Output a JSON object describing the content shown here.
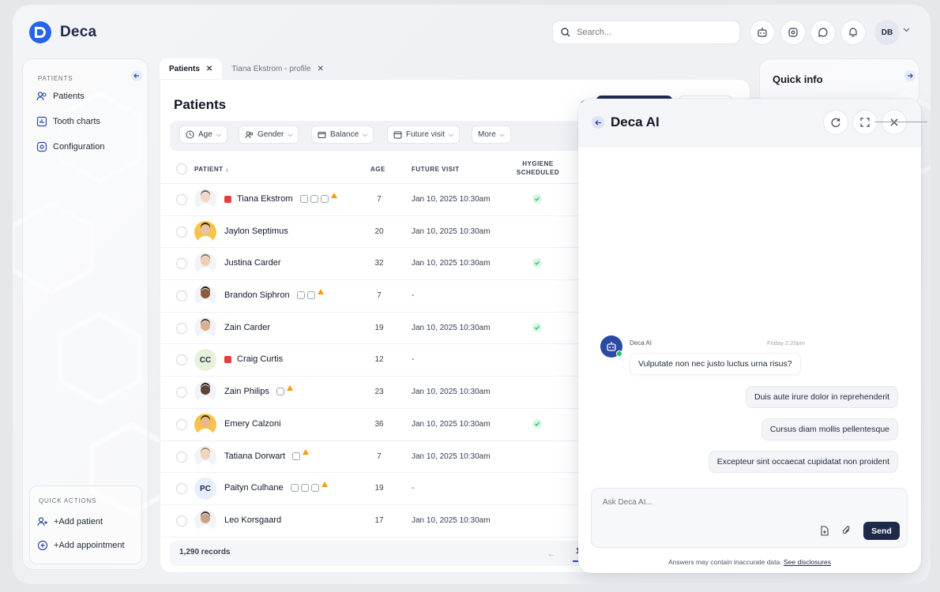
{
  "app": {
    "name": "Deca"
  },
  "search": {
    "placeholder": "Search..."
  },
  "user": {
    "initials": "DB"
  },
  "sidebar": {
    "section_label": "PATIENTS",
    "items": [
      {
        "label": "Patients",
        "icon": "users-icon"
      },
      {
        "label": "Tooth charts",
        "icon": "chart-icon"
      },
      {
        "label": "Configuration",
        "icon": "settings-icon"
      }
    ],
    "quick_actions_label": "QUICK ACTIONS",
    "quick_actions": [
      {
        "label": "+Add patient",
        "icon": "add-user-icon"
      },
      {
        "label": "+Add appointment",
        "icon": "add-calendar-icon"
      }
    ]
  },
  "tabs": [
    {
      "label": "Patients",
      "active": true
    },
    {
      "label": "Tiana Ekstrom - profile",
      "active": false
    }
  ],
  "main": {
    "title": "Patients",
    "filters": [
      "Age",
      "Gender",
      "Balance",
      "Future visit",
      "More"
    ],
    "columns": {
      "patient": "PATIENT",
      "age": "AGE",
      "future_visit": "FUTURE VISIT",
      "hygiene": "HYGIENE SCHEDULED"
    },
    "rows": [
      {
        "name": "Tiana Ekstrom",
        "age": "7",
        "visit": "Jan 10, 2025 10:30am",
        "hygiene": true,
        "flag": true,
        "icons": 3,
        "warn": true,
        "avatar": "photo",
        "initials": ""
      },
      {
        "name": "Jaylon Septimus",
        "age": "20",
        "visit": "Jan 10, 2025 10:30am",
        "hygiene": false,
        "flag": false,
        "icons": 0,
        "warn": false,
        "avatar": "photo",
        "initials": ""
      },
      {
        "name": "Justina Carder",
        "age": "32",
        "visit": "Jan 10, 2025 10:30am",
        "hygiene": true,
        "flag": false,
        "icons": 0,
        "warn": false,
        "avatar": "photo",
        "initials": ""
      },
      {
        "name": "Brandon Siphron",
        "age": "7",
        "visit": "-",
        "hygiene": false,
        "flag": false,
        "icons": 2,
        "warn": true,
        "avatar": "photo",
        "initials": ""
      },
      {
        "name": "Zain Carder",
        "age": "19",
        "visit": "Jan 10, 2025 10:30am",
        "hygiene": true,
        "flag": false,
        "icons": 0,
        "warn": false,
        "avatar": "photo",
        "initials": ""
      },
      {
        "name": "Craig Curtis",
        "age": "12",
        "visit": "-",
        "hygiene": false,
        "flag": true,
        "icons": 0,
        "warn": false,
        "avatar": "initials",
        "initials": "CC"
      },
      {
        "name": "Zain Philips",
        "age": "23",
        "visit": "Jan 10, 2025 10:30am",
        "hygiene": false,
        "flag": false,
        "icons": 1,
        "warn": true,
        "avatar": "photo",
        "initials": ""
      },
      {
        "name": "Emery Calzoni",
        "age": "36",
        "visit": "Jan 10, 2025 10:30am",
        "hygiene": true,
        "flag": false,
        "icons": 0,
        "warn": false,
        "avatar": "photo",
        "initials": ""
      },
      {
        "name": "Tatiana Dorwart",
        "age": "7",
        "visit": "Jan 10, 2025 10:30am",
        "hygiene": false,
        "flag": false,
        "icons": 1,
        "warn": true,
        "avatar": "photo",
        "initials": ""
      },
      {
        "name": "Paityn Culhane",
        "age": "19",
        "visit": "-",
        "hygiene": false,
        "flag": false,
        "icons": 3,
        "warn": true,
        "avatar": "initials",
        "initials": "PC"
      },
      {
        "name": "Leo Korsgaard",
        "age": "17",
        "visit": "Jan 10, 2025 10:30am",
        "hygiene": false,
        "flag": false,
        "icons": 0,
        "warn": false,
        "avatar": "photo",
        "initials": ""
      }
    ],
    "records": "1,290 records",
    "page": "1"
  },
  "quick_info": {
    "title": "Quick info"
  },
  "ai": {
    "title": "Deca AI",
    "sender": "Deca AI",
    "time": "Friday 2:20pm",
    "bot_message": "Vulputate non nec justo luctus urna risus?",
    "user_messages": [
      "Duis aute irure dolor in reprehenderit",
      "Cursus diam mollis pellentesque",
      "Excepteur sint occaecat cupidatat non proident"
    ],
    "input_placeholder": "Ask Deca AI...",
    "send_label": "Send",
    "disclaimer": "Answers may contain inaccurate data.",
    "disclaimer_link": "See disclosures"
  },
  "colors": {
    "brand": "#1e2a4a",
    "accent": "#2b4aa5",
    "success": "#22c55e",
    "flag": "#e53e3e",
    "warning": "#f59e0b"
  }
}
